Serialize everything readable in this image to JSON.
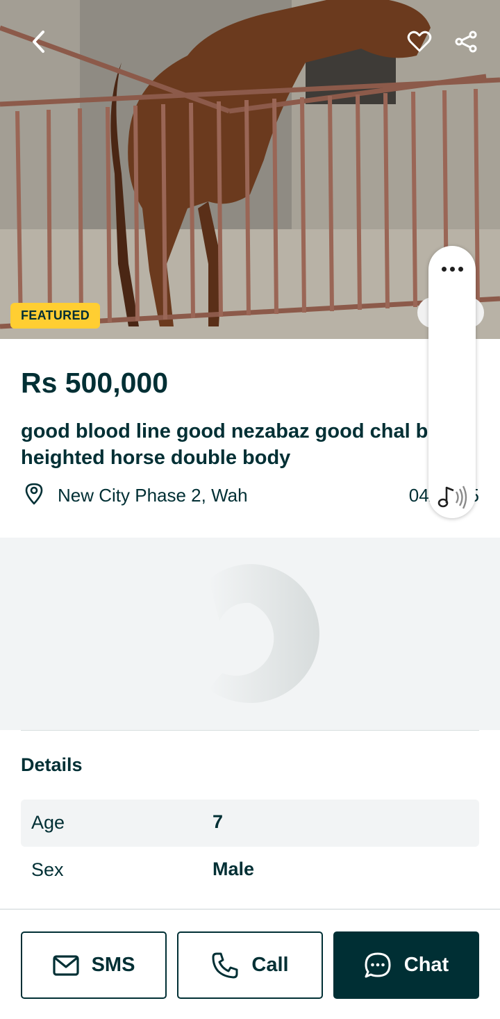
{
  "listing": {
    "badge": "FEATURED",
    "price": "Rs 500,000",
    "title": "good blood line good nezabaz good chal bad heighted horse double body",
    "location": "New City Phase 2, Wah",
    "date": "04/04/25"
  },
  "details": {
    "heading": "Details",
    "rows": [
      {
        "key": "Age",
        "value": "7"
      },
      {
        "key": "Sex",
        "value": "Male"
      }
    ]
  },
  "actions": {
    "sms_label": "SMS",
    "call_label": "Call",
    "chat_label": "Chat"
  },
  "icons": {
    "back": "chevron-left-icon",
    "favorite": "heart-icon",
    "share": "share-icon",
    "location": "location-pin-icon",
    "sms": "envelope-icon",
    "call": "phone-icon",
    "chat": "chat-bubble-icon",
    "overlay_menu": "more-dots-icon",
    "overlay_audio": "music-note-icon"
  },
  "colors": {
    "primary": "#002f34",
    "badge": "#ffce32",
    "surface": "#f2f4f5"
  }
}
